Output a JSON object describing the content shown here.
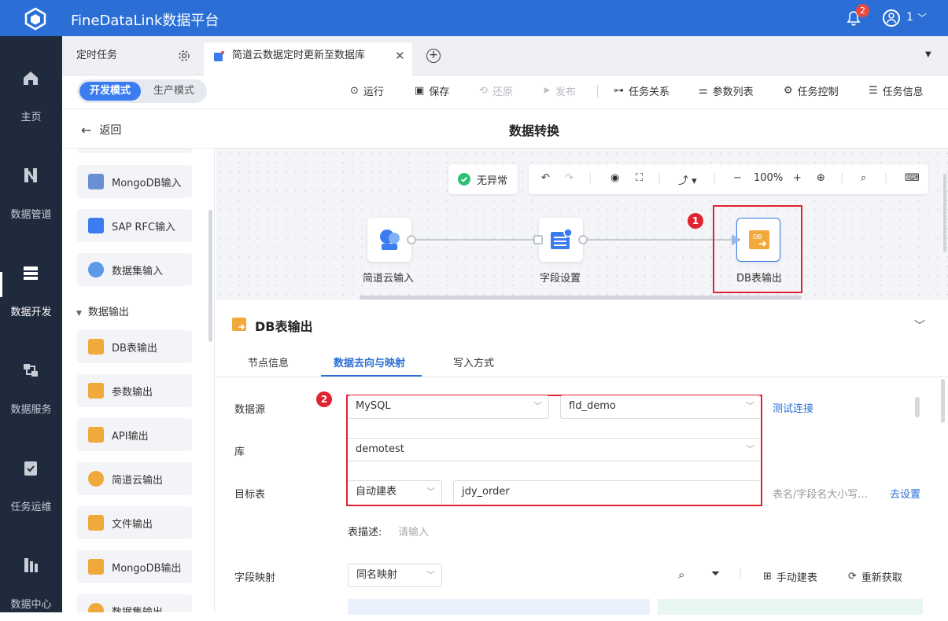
{
  "app": {
    "title": "FineDataLink数据平台",
    "notifications": "2",
    "user": "1"
  },
  "nav": [
    {
      "label": "主页",
      "icon": "home-icon"
    },
    {
      "label": "数据管道",
      "icon": "pipeline-icon"
    },
    {
      "label": "数据开发",
      "icon": "dev-icon"
    },
    {
      "label": "数据服务",
      "icon": "service-icon"
    },
    {
      "label": "任务运维",
      "icon": "ops-icon"
    },
    {
      "label": "数据中心",
      "icon": "datacenter-icon"
    }
  ],
  "tabs": {
    "tab1": "定时任务",
    "tab2": "简道云数据定时更新至数据库"
  },
  "mode": {
    "dev": "开发模式",
    "prod": "生产模式"
  },
  "toolbar": {
    "run": "运行",
    "save": "保存",
    "restore": "还原",
    "publish": "发布",
    "relation": "任务关系",
    "params": "参数列表",
    "control": "任务控制",
    "info": "任务信息"
  },
  "subhead": {
    "back": "返回",
    "title": "数据转换"
  },
  "palette": {
    "items_top": [
      "MongoDB输入",
      "SAP RFC输入",
      "数据集输入"
    ],
    "group": "数据输出",
    "items_bottom": [
      "DB表输出",
      "参数输出",
      "API输出",
      "简道云输出",
      "文件输出",
      "MongoDB输出",
      "数据集输出"
    ]
  },
  "canvas": {
    "status": "无异常",
    "zoom": "100%",
    "nodes": [
      "简道云输入",
      "字段设置",
      "DB表输出"
    ],
    "badge1": "1"
  },
  "panel": {
    "title": "DB表输出",
    "tabs": [
      "节点信息",
      "数据去向与映射",
      "写入方式"
    ],
    "badge2": "2",
    "labels": {
      "datasource": "数据源",
      "db": "库",
      "target": "目标表",
      "desc": "表描述:",
      "mapping": "字段映射"
    },
    "datasource_type": "MySQL",
    "datasource_name": "fld_demo",
    "test_conn": "测试连接",
    "database": "demotest",
    "create_mode": "自动建表",
    "table_name": "jdy_order",
    "case_hint": "表名/字段名大小写...",
    "go_set": "去设置",
    "desc_placeholder": "请输入",
    "mapping_mode": "同名映射",
    "manual_create": "手动建表",
    "refetch": "重新获取"
  }
}
